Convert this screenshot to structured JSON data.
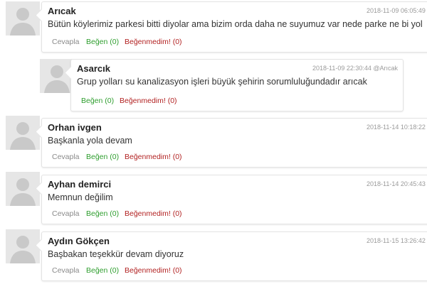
{
  "colors": {
    "like": "#2e9e2e",
    "dislike": "#b22222",
    "reply": "#8a8a8a",
    "meta": "#9a9a9a"
  },
  "comments": [
    {
      "author": "Arıcak",
      "meta": "2018-11-09 06:05:49",
      "text": "Bütün köylerimiz parkesi bitti diyolar ama bizim orda daha ne suyumuz var nede parke ne bi yol",
      "reply_label": "Cevapla",
      "like_label": "Beğen (0)",
      "dislike_label": "Beğenmedim! (0)",
      "avatar_icon": "user-placeholder-icon"
    },
    {
      "author": "Asarcık",
      "meta": "2018-11-09 22:30:44 @Arıcak",
      "text": "Grup yolları su kanalizasyon işleri büyük şehirin sorumluluğundadır arıcak",
      "like_label": "Beğen (0)",
      "dislike_label": "Beğenmedim! (0)",
      "avatar_icon": "user-placeholder-icon"
    },
    {
      "author": "Orhan ivgen",
      "meta": "2018-11-14 10:18:22",
      "text": "Başkanla yola devam",
      "reply_label": "Cevapla",
      "like_label": "Beğen (0)",
      "dislike_label": "Beğenmedim! (0)",
      "avatar_icon": "user-placeholder-icon"
    },
    {
      "author": "Ayhan demirci",
      "meta": "2018-11-14 20:45:43",
      "text": "Memnun değilim",
      "reply_label": "Cevapla",
      "like_label": "Beğen (0)",
      "dislike_label": "Beğenmedim! (0)",
      "avatar_icon": "user-placeholder-icon"
    },
    {
      "author": "Aydın Gökçen",
      "meta": "2018-11-15 13:26:42",
      "text": "Başbakan teşekkür devam diyoruz",
      "reply_label": "Cevapla",
      "like_label": "Beğen (0)",
      "dislike_label": "Beğenmedim! (0)",
      "avatar_icon": "user-placeholder-icon"
    }
  ]
}
